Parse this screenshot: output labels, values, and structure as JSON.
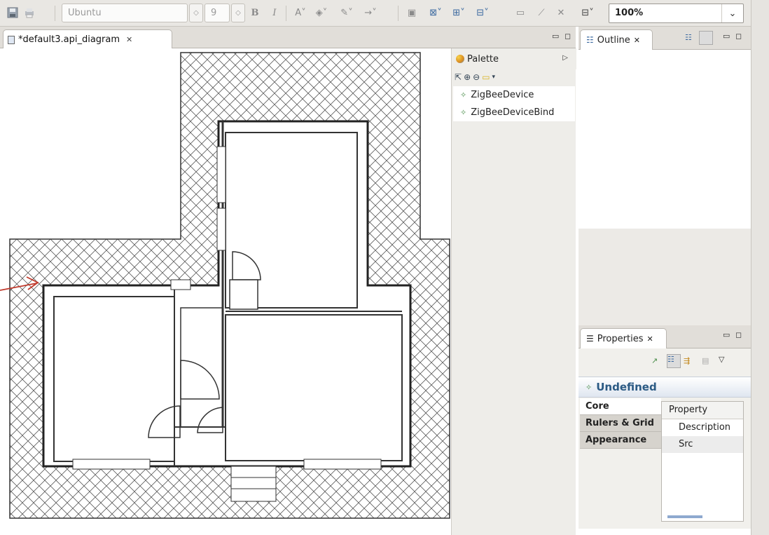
{
  "toolbar": {
    "font_name": "Ubuntu",
    "font_size": "9",
    "zoom": "100%"
  },
  "editor": {
    "tab_title": "*default3.api_diagram",
    "tab_close": "✕"
  },
  "palette": {
    "title": "Palette",
    "items": [
      {
        "label": "ZigBeeDevice"
      },
      {
        "label": "ZigBeeDeviceBind"
      }
    ]
  },
  "outline": {
    "title": "Outline",
    "tab_close": "✕"
  },
  "properties": {
    "title": "Properties",
    "tab_close": "✕",
    "heading": "Undefined",
    "tabs": [
      "Core",
      "Rulers & Grid",
      "Appearance"
    ],
    "column_header": "Property",
    "rows": [
      "Description",
      "Src"
    ]
  },
  "colors": {
    "accent": "#2b5a84",
    "arrow": "#c0392b",
    "toolbar_bg": "#e9e7e3"
  },
  "icons": [
    "save-icon",
    "print-icon",
    "bold-icon",
    "italic-icon",
    "font-color-icon",
    "fill-color-icon",
    "line-color-icon",
    "arrow-style-icon",
    "layout-icon",
    "zoom-in-icon",
    "zoom-out-icon",
    "select-tool-icon",
    "note-tool-icon"
  ]
}
